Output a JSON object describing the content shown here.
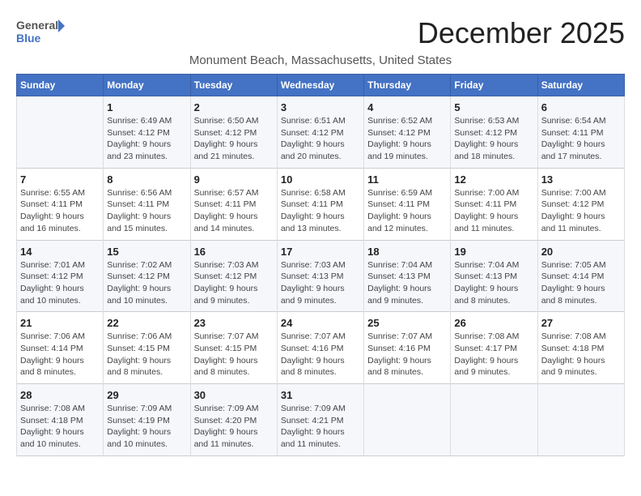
{
  "logo": {
    "line1": "General",
    "line2": "Blue"
  },
  "title": "December 2025",
  "location": "Monument Beach, Massachusetts, United States",
  "headers": [
    "Sunday",
    "Monday",
    "Tuesday",
    "Wednesday",
    "Thursday",
    "Friday",
    "Saturday"
  ],
  "weeks": [
    [
      {
        "day": "",
        "info": ""
      },
      {
        "day": "1",
        "info": "Sunrise: 6:49 AM\nSunset: 4:12 PM\nDaylight: 9 hours\nand 23 minutes."
      },
      {
        "day": "2",
        "info": "Sunrise: 6:50 AM\nSunset: 4:12 PM\nDaylight: 9 hours\nand 21 minutes."
      },
      {
        "day": "3",
        "info": "Sunrise: 6:51 AM\nSunset: 4:12 PM\nDaylight: 9 hours\nand 20 minutes."
      },
      {
        "day": "4",
        "info": "Sunrise: 6:52 AM\nSunset: 4:12 PM\nDaylight: 9 hours\nand 19 minutes."
      },
      {
        "day": "5",
        "info": "Sunrise: 6:53 AM\nSunset: 4:12 PM\nDaylight: 9 hours\nand 18 minutes."
      },
      {
        "day": "6",
        "info": "Sunrise: 6:54 AM\nSunset: 4:11 PM\nDaylight: 9 hours\nand 17 minutes."
      }
    ],
    [
      {
        "day": "7",
        "info": "Sunrise: 6:55 AM\nSunset: 4:11 PM\nDaylight: 9 hours\nand 16 minutes."
      },
      {
        "day": "8",
        "info": "Sunrise: 6:56 AM\nSunset: 4:11 PM\nDaylight: 9 hours\nand 15 minutes."
      },
      {
        "day": "9",
        "info": "Sunrise: 6:57 AM\nSunset: 4:11 PM\nDaylight: 9 hours\nand 14 minutes."
      },
      {
        "day": "10",
        "info": "Sunrise: 6:58 AM\nSunset: 4:11 PM\nDaylight: 9 hours\nand 13 minutes."
      },
      {
        "day": "11",
        "info": "Sunrise: 6:59 AM\nSunset: 4:11 PM\nDaylight: 9 hours\nand 12 minutes."
      },
      {
        "day": "12",
        "info": "Sunrise: 7:00 AM\nSunset: 4:11 PM\nDaylight: 9 hours\nand 11 minutes."
      },
      {
        "day": "13",
        "info": "Sunrise: 7:00 AM\nSunset: 4:12 PM\nDaylight: 9 hours\nand 11 minutes."
      }
    ],
    [
      {
        "day": "14",
        "info": "Sunrise: 7:01 AM\nSunset: 4:12 PM\nDaylight: 9 hours\nand 10 minutes."
      },
      {
        "day": "15",
        "info": "Sunrise: 7:02 AM\nSunset: 4:12 PM\nDaylight: 9 hours\nand 10 minutes."
      },
      {
        "day": "16",
        "info": "Sunrise: 7:03 AM\nSunset: 4:12 PM\nDaylight: 9 hours\nand 9 minutes."
      },
      {
        "day": "17",
        "info": "Sunrise: 7:03 AM\nSunset: 4:13 PM\nDaylight: 9 hours\nand 9 minutes."
      },
      {
        "day": "18",
        "info": "Sunrise: 7:04 AM\nSunset: 4:13 PM\nDaylight: 9 hours\nand 9 minutes."
      },
      {
        "day": "19",
        "info": "Sunrise: 7:04 AM\nSunset: 4:13 PM\nDaylight: 9 hours\nand 8 minutes."
      },
      {
        "day": "20",
        "info": "Sunrise: 7:05 AM\nSunset: 4:14 PM\nDaylight: 9 hours\nand 8 minutes."
      }
    ],
    [
      {
        "day": "21",
        "info": "Sunrise: 7:06 AM\nSunset: 4:14 PM\nDaylight: 9 hours\nand 8 minutes."
      },
      {
        "day": "22",
        "info": "Sunrise: 7:06 AM\nSunset: 4:15 PM\nDaylight: 9 hours\nand 8 minutes."
      },
      {
        "day": "23",
        "info": "Sunrise: 7:07 AM\nSunset: 4:15 PM\nDaylight: 9 hours\nand 8 minutes."
      },
      {
        "day": "24",
        "info": "Sunrise: 7:07 AM\nSunset: 4:16 PM\nDaylight: 9 hours\nand 8 minutes."
      },
      {
        "day": "25",
        "info": "Sunrise: 7:07 AM\nSunset: 4:16 PM\nDaylight: 9 hours\nand 8 minutes."
      },
      {
        "day": "26",
        "info": "Sunrise: 7:08 AM\nSunset: 4:17 PM\nDaylight: 9 hours\nand 9 minutes."
      },
      {
        "day": "27",
        "info": "Sunrise: 7:08 AM\nSunset: 4:18 PM\nDaylight: 9 hours\nand 9 minutes."
      }
    ],
    [
      {
        "day": "28",
        "info": "Sunrise: 7:08 AM\nSunset: 4:18 PM\nDaylight: 9 hours\nand 10 minutes."
      },
      {
        "day": "29",
        "info": "Sunrise: 7:09 AM\nSunset: 4:19 PM\nDaylight: 9 hours\nand 10 minutes."
      },
      {
        "day": "30",
        "info": "Sunrise: 7:09 AM\nSunset: 4:20 PM\nDaylight: 9 hours\nand 11 minutes."
      },
      {
        "day": "31",
        "info": "Sunrise: 7:09 AM\nSunset: 4:21 PM\nDaylight: 9 hours\nand 11 minutes."
      },
      {
        "day": "",
        "info": ""
      },
      {
        "day": "",
        "info": ""
      },
      {
        "day": "",
        "info": ""
      }
    ]
  ]
}
